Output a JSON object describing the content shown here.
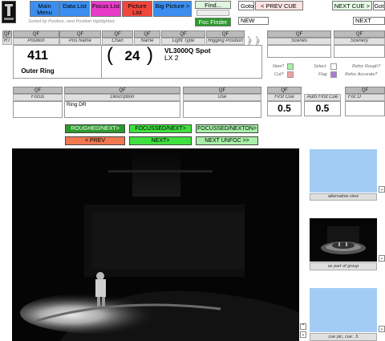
{
  "nav": {
    "main_menu": "Main Menu",
    "data_list": "Data List",
    "focus_list": "Focus List",
    "picture_list": "Picture List",
    "big_picture": "Big Picture >",
    "find": "Find...",
    "foc_finder": "Foc Finder",
    "goto": "Goto",
    "prev_cue": "< PREV CUE",
    "next_cue": "NEXT CUE >",
    "goto2": "Got",
    "new_only": "NEW only",
    "next_new": "NEXT new",
    "sort_note": "Sorted by Position, next Position highlighted."
  },
  "headers": {
    "qf": "QF",
    "rt": "RT",
    "position": "Position",
    "pos_name": "Pos Name",
    "chan": "Chan",
    "name": "Name",
    "light_type": "Light Type",
    "rigging_position": "Rigging Position",
    "scenes": "Scenes",
    "scenery": "Scenery",
    "focus": "Focus",
    "description": "Description",
    "use": "Use",
    "first_cue": "First Cue",
    "auto_first_cue": "Auto First Cue",
    "foc_d": "Foc D"
  },
  "record": {
    "position": "411",
    "pos_name": "Outer Ring",
    "chan": "24",
    "light_type": "VL3000Q Spot",
    "rigging_position": "LX 2",
    "description": "Ring DR",
    "first_cue": "0.5",
    "auto_first_cue": "0.5"
  },
  "flags": {
    "new": "New?",
    "cut": "Cut?",
    "select": "Select",
    "flag": "Flag",
    "refoc_rough": "Refoc Rough?",
    "refoc_accurate": "Refoc Accurate?",
    "play1": "Play?",
    "play2": "Play?"
  },
  "buttons": {
    "roughed_next": "ROUGHED/NEXT>",
    "focussed_next": "FOCUSSED/NEXT>",
    "focussed_nexton": "FOCUSSED/NEXTON>",
    "prev": "< PREV",
    "next": "NEXT>",
    "next_unfoc": "NEXT UNFOC >>"
  },
  "captions": {
    "alt_view": "alternative view",
    "part_of_group": "as part of group",
    "cue_pic": "cue pic, cue: .5"
  },
  "colors": {
    "blue_btn": "#3b8ef0",
    "pink_btn": "#e83cc8",
    "red_btn": "#f0463c",
    "green_dark": "#2b9a2b",
    "green_bright": "#41e041",
    "green_pale": "#a8f0a8",
    "salmon": "#f07850",
    "placeholder_blue": "#a3ccf5"
  }
}
